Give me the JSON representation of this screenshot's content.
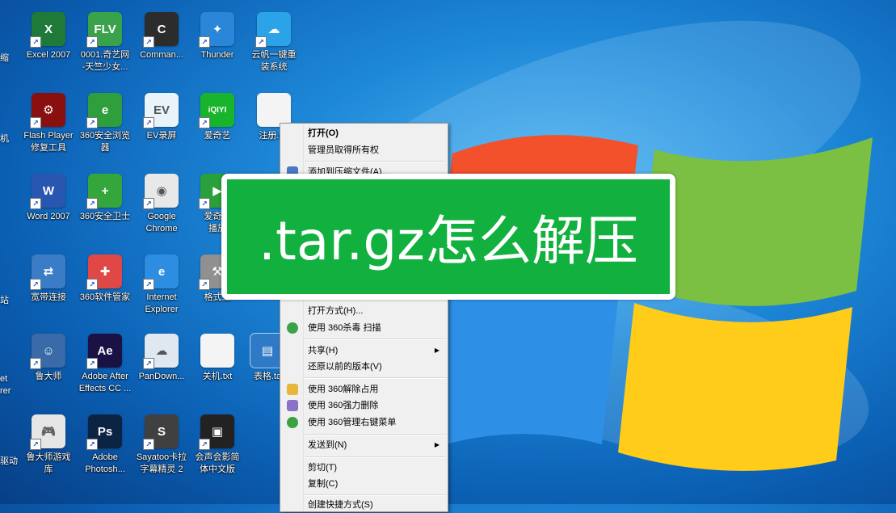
{
  "desktop": {
    "icons": [
      {
        "label": "Excel 2007",
        "glyph": "X",
        "color": "#1f7a3a"
      },
      {
        "label": "0001.奇艺网\n-天竺少女...",
        "glyph": "FLV",
        "color": "#3aa24a"
      },
      {
        "label": "Comman...",
        "glyph": "C",
        "color": "#2c2c2c"
      },
      {
        "label": "Thunder",
        "glyph": "✦",
        "color": "#2a86d8"
      },
      {
        "label": "云帆一键重\n装系统",
        "glyph": "☁",
        "color": "#2aa3e8"
      },
      {
        "label": "Flash Player\n修复工具",
        "glyph": "⚙",
        "color": "#8a1010"
      },
      {
        "label": "360安全浏览\n器",
        "glyph": "e",
        "color": "#2f9e3c"
      },
      {
        "label": "EV录屏",
        "glyph": "EV",
        "color": "#e9f4fa"
      },
      {
        "label": "爱奇艺",
        "glyph": "iQIYI",
        "color": "#18b42c"
      },
      {
        "label": "注册.t...",
        "glyph": "",
        "color": "#f4f4f4"
      },
      {
        "label": "Word 2007",
        "glyph": "W",
        "color": "#2856b0"
      },
      {
        "label": "360安全卫士",
        "glyph": "+",
        "color": "#35a63c"
      },
      {
        "label": "Google\nChrome",
        "glyph": "◉",
        "color": "#e8e8e8"
      },
      {
        "label": "爱奇艺\n播放",
        "glyph": "▶",
        "color": "#2aa03a"
      },
      {
        "label": "宽带连接",
        "glyph": "⇄",
        "color": "#3a7cc6"
      },
      {
        "label": "360软件管家",
        "glyph": "✚",
        "color": "#e04848"
      },
      {
        "label": "Internet\nExplorer",
        "glyph": "e",
        "color": "#2d8de0"
      },
      {
        "label": "格式工",
        "glyph": "⚒",
        "color": "#909090"
      },
      {
        "label": "鲁大师",
        "glyph": "☺",
        "color": "#3a6aa8"
      },
      {
        "label": "Adobe After\nEffects CC ...",
        "glyph": "Ae",
        "color": "#1a1245"
      },
      {
        "label": "PanDown...",
        "glyph": "☁",
        "color": "#dfe8f0"
      },
      {
        "label": "关机.txt",
        "glyph": "",
        "color": "#f4f4f4"
      },
      {
        "label": "表格.ta",
        "glyph": "▤",
        "color": "#2f7ac6"
      },
      {
        "label": "鲁大师游戏\n库",
        "glyph": "🎮",
        "color": "#e6e6e6"
      },
      {
        "label": "Adobe\nPhotosh...",
        "glyph": "Ps",
        "color": "#0c2444"
      },
      {
        "label": "Sayatoo卡拉\n字幕精灵 2",
        "glyph": "S",
        "color": "#404040"
      },
      {
        "label": "会声会影简\n体中文版",
        "glyph": "▣",
        "color": "#222"
      }
    ],
    "edge_labels": [
      "缩",
      "机",
      "",
      "站",
      "et\nrer",
      "驱动"
    ]
  },
  "context_menu": {
    "items": [
      {
        "label": "打开(O)",
        "bold": true
      },
      {
        "label": "管理员取得所有权"
      },
      {
        "label": "添加到压缩文件(A)...",
        "icon": "archive-icon"
      },
      {
        "label": "打开方式(H)..."
      },
      {
        "label": "使用 360杀毒 扫描",
        "icon": "shield-icon"
      },
      {
        "label": "共享(H)",
        "submenu": true
      },
      {
        "label": "还原以前的版本(V)"
      },
      {
        "label": "使用 360解除占用",
        "icon": "unlock-icon"
      },
      {
        "label": "使用 360强力删除",
        "icon": "delete-icon"
      },
      {
        "label": "使用 360管理右键菜单",
        "icon": "menu-icon"
      },
      {
        "label": "发送到(N)",
        "submenu": true
      },
      {
        "label": "剪切(T)"
      },
      {
        "label": "复制(C)"
      },
      {
        "label": "创建快捷方式(S)"
      }
    ]
  },
  "overlay": {
    "title": ".tar.gz怎么解压",
    "background_color": "#12b03f"
  }
}
